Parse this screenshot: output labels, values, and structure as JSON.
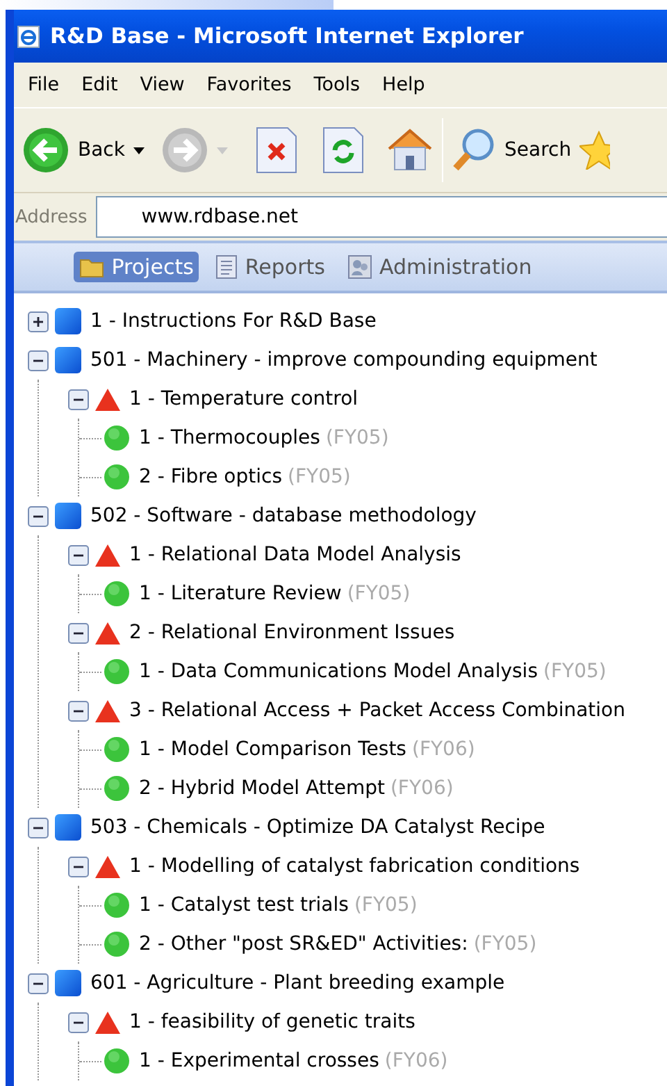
{
  "window": {
    "title": "R&D Base - Microsoft Internet Explorer"
  },
  "menu": [
    "File",
    "Edit",
    "View",
    "Favorites",
    "Tools",
    "Help"
  ],
  "toolbar": {
    "back_label": "Back",
    "forward_disabled": true,
    "search_label": "Search"
  },
  "address": {
    "label": "Address",
    "value": "www.rdbase.net"
  },
  "nav_tabs": [
    {
      "label": "Projects",
      "kind": "folder",
      "selected": true
    },
    {
      "label": "Reports",
      "kind": "report",
      "selected": false
    },
    {
      "label": "Administration",
      "kind": "admin",
      "selected": false
    }
  ],
  "tree": [
    {
      "kind": "project",
      "label": "1 - Instructions For R&D Base",
      "expanded": false
    },
    {
      "kind": "project",
      "label": "501 - Machinery - improve compounding equipment",
      "expanded": true,
      "children": [
        {
          "kind": "task",
          "label": "1 - Temperature control",
          "expanded": true,
          "children": [
            {
              "kind": "activity",
              "label": "1 - Thermocouples",
              "fy": "(FY05)"
            },
            {
              "kind": "activity",
              "label": "2 - Fibre optics",
              "fy": "(FY05)"
            }
          ]
        }
      ]
    },
    {
      "kind": "project",
      "label": "502 - Software - database methodology",
      "expanded": true,
      "children": [
        {
          "kind": "task",
          "label": "1 - Relational Data Model Analysis",
          "expanded": true,
          "children": [
            {
              "kind": "activity",
              "label": "1 - Literature Review",
              "fy": "(FY05)"
            }
          ]
        },
        {
          "kind": "task",
          "label": "2 - Relational Environment Issues",
          "expanded": true,
          "children": [
            {
              "kind": "activity",
              "label": "1 - Data Communications Model Analysis",
              "fy": "(FY05)"
            }
          ]
        },
        {
          "kind": "task",
          "label": "3 - Relational Access + Packet Access Combination",
          "expanded": true,
          "children": [
            {
              "kind": "activity",
              "label": "1 - Model Comparison Tests",
              "fy": "(FY06)"
            },
            {
              "kind": "activity",
              "label": "2 - Hybrid Model Attempt",
              "fy": "(FY06)"
            }
          ]
        }
      ]
    },
    {
      "kind": "project",
      "label": "503 - Chemicals - Optimize DA Catalyst Recipe",
      "expanded": true,
      "children": [
        {
          "kind": "task",
          "label": "1 - Modelling of catalyst fabrication conditions",
          "expanded": true,
          "children": [
            {
              "kind": "activity",
              "label": "1 - Catalyst test trials",
              "fy": "(FY05)"
            },
            {
              "kind": "activity",
              "label": "2 - Other \"post SR&ED\" Activities:",
              "fy": "(FY05)"
            }
          ]
        }
      ]
    },
    {
      "kind": "project",
      "label": "601 - Agriculture - Plant breeding example",
      "expanded": true,
      "children": [
        {
          "kind": "task",
          "label": "1 - feasibility of genetic traits",
          "expanded": true,
          "children": [
            {
              "kind": "activity",
              "label": "1 - Experimental crosses",
              "fy": "(FY06)"
            }
          ]
        }
      ]
    }
  ]
}
